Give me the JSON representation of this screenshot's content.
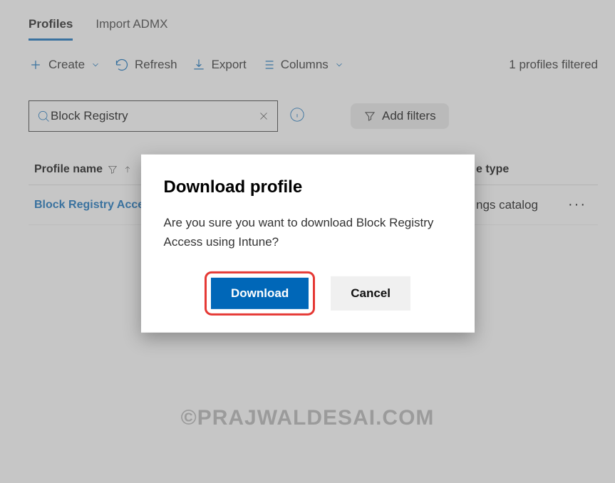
{
  "tabs": {
    "profiles": "Profiles",
    "import_admx": "Import ADMX"
  },
  "toolbar": {
    "create": "Create",
    "refresh": "Refresh",
    "export": "Export",
    "columns": "Columns"
  },
  "filter_count": "1 profiles filtered",
  "search_value": "Block Registry",
  "add_filters": "Add filters",
  "table": {
    "header_name": "Profile name",
    "header_type": "e type",
    "rows": [
      {
        "name": "Block Registry Acce",
        "type": "ngs catalog"
      }
    ]
  },
  "dialog": {
    "title": "Download profile",
    "body": "Are you sure you want to download Block Registry Access using Intune?",
    "download": "Download",
    "cancel": "Cancel"
  },
  "watermark": "©PRAJWALDESAI.COM"
}
